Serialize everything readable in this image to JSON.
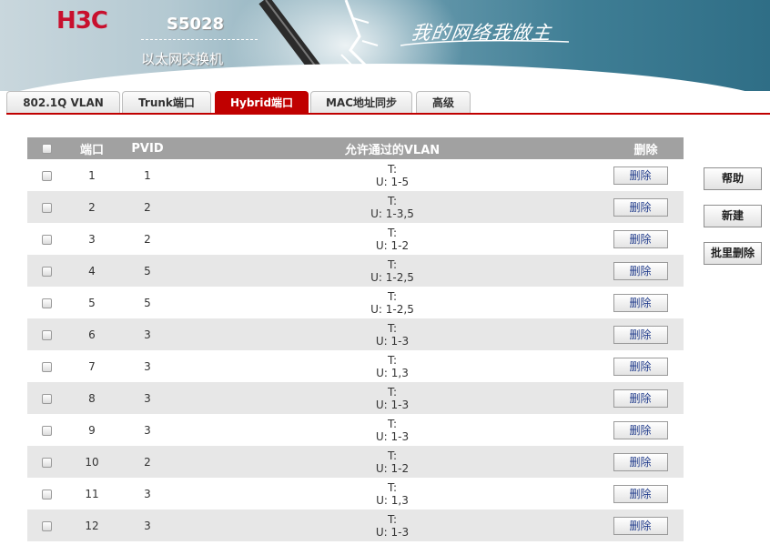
{
  "header": {
    "logo": "H3C",
    "model": "S5028",
    "device_type": "以太网交换机",
    "slogan": "我的网络我做主"
  },
  "tabs": [
    {
      "label": "802.1Q VLAN",
      "active": false
    },
    {
      "label": "Trunk端口",
      "active": false
    },
    {
      "label": "Hybrid端口",
      "active": true
    },
    {
      "label": "MAC地址同步",
      "active": false
    },
    {
      "label": "高级",
      "active": false
    }
  ],
  "table": {
    "headers": {
      "port": "端口",
      "pvid": "PVID",
      "allowed_vlan": "允许通过的VLAN",
      "delete": "删除"
    },
    "delete_label": "删除",
    "rows": [
      {
        "port": "1",
        "pvid": "1",
        "tagged": "T:",
        "untagged": "U: 1-5"
      },
      {
        "port": "2",
        "pvid": "2",
        "tagged": "T:",
        "untagged": "U: 1-3,5"
      },
      {
        "port": "3",
        "pvid": "2",
        "tagged": "T:",
        "untagged": "U: 1-2"
      },
      {
        "port": "4",
        "pvid": "5",
        "tagged": "T:",
        "untagged": "U: 1-2,5"
      },
      {
        "port": "5",
        "pvid": "5",
        "tagged": "T:",
        "untagged": "U: 1-2,5"
      },
      {
        "port": "6",
        "pvid": "3",
        "tagged": "T:",
        "untagged": "U: 1-3"
      },
      {
        "port": "7",
        "pvid": "3",
        "tagged": "T:",
        "untagged": "U: 1,3"
      },
      {
        "port": "8",
        "pvid": "3",
        "tagged": "T:",
        "untagged": "U: 1-3"
      },
      {
        "port": "9",
        "pvid": "3",
        "tagged": "T:",
        "untagged": "U: 1-3"
      },
      {
        "port": "10",
        "pvid": "2",
        "tagged": "T:",
        "untagged": "U: 1-2"
      },
      {
        "port": "11",
        "pvid": "3",
        "tagged": "T:",
        "untagged": "U: 1,3"
      },
      {
        "port": "12",
        "pvid": "3",
        "tagged": "T:",
        "untagged": "U: 1-3"
      }
    ]
  },
  "side_buttons": {
    "help": "帮助",
    "new": "新建",
    "batch_delete": "批里删除"
  },
  "colors": {
    "accent": "#c00000",
    "header_bg": "#a1a1a1",
    "row_alt": "#e7e7e7",
    "logo_red": "#c8102e"
  }
}
